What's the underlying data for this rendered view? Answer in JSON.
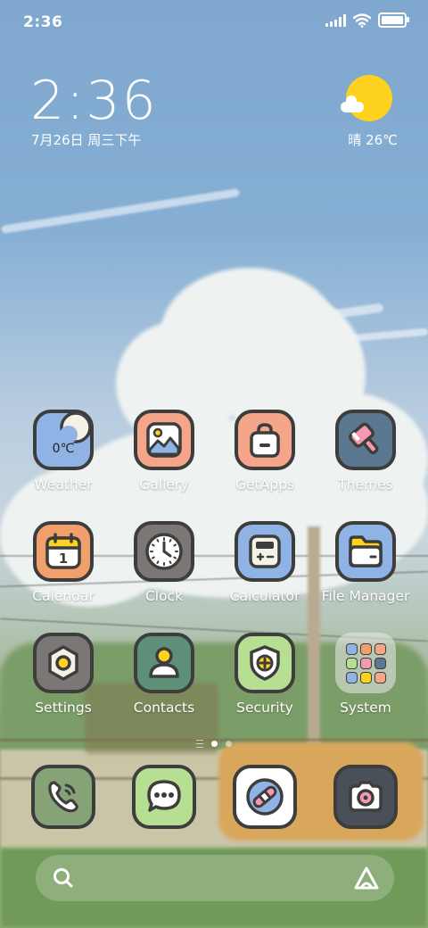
{
  "status_bar": {
    "time": "2:36"
  },
  "clock_widget": {
    "time": "2:36",
    "date": "7月26日 周三下午"
  },
  "weather_widget": {
    "text": "晴 26℃"
  },
  "apps": [
    {
      "name": "app-weather",
      "label": "Weather",
      "bg": "#8fb3e4",
      "icon": "weather-icon",
      "inner": "0℃"
    },
    {
      "name": "app-gallery",
      "label": "Gallery",
      "bg": "#f4a58a",
      "icon": "gallery-icon"
    },
    {
      "name": "app-getapps",
      "label": "GetApps",
      "bg": "#f4a58a",
      "icon": "shopping-bag-icon"
    },
    {
      "name": "app-themes",
      "label": "Themes",
      "bg": "#5c7891",
      "icon": "paintbrush-icon"
    },
    {
      "name": "app-calendar",
      "label": "Calendar",
      "bg": "#f2a06b",
      "icon": "calendar-icon",
      "inner": "1"
    },
    {
      "name": "app-clock",
      "label": "Clock",
      "bg": "#7b7774",
      "icon": "clock-icon"
    },
    {
      "name": "app-calculator",
      "label": "Calculator",
      "bg": "#8fb3e4",
      "icon": "calculator-icon"
    },
    {
      "name": "app-file-manager",
      "label": "File Manager",
      "bg": "#8fb3e4",
      "icon": "folder-icon"
    },
    {
      "name": "app-settings",
      "label": "Settings",
      "bg": "#7b7774",
      "icon": "gear-icon"
    },
    {
      "name": "app-contacts",
      "label": "Contacts",
      "bg": "#5e8f79",
      "icon": "person-icon"
    },
    {
      "name": "app-security",
      "label": "Security",
      "bg": "#b7df94",
      "icon": "shield-icon"
    },
    {
      "name": "app-system-folder",
      "label": "System",
      "icon": "folder-grid-icon"
    }
  ],
  "dock": [
    {
      "name": "dock-phone",
      "icon": "phone-icon",
      "bg": "#86a377"
    },
    {
      "name": "dock-messages",
      "icon": "message-bubble-icon",
      "bg": "#b7df94"
    },
    {
      "name": "dock-browser",
      "icon": "browser-icon",
      "bg": "#ffffff"
    },
    {
      "name": "dock-camera",
      "icon": "camera-icon",
      "bg": "#4a5058"
    }
  ],
  "search_bar": {
    "left_icon": "search-icon",
    "right_icon": "assistant-icon"
  },
  "colors": {
    "icon_outline": "#3d3d3d",
    "sun": "#ffd21f",
    "text": "#ffffff"
  }
}
